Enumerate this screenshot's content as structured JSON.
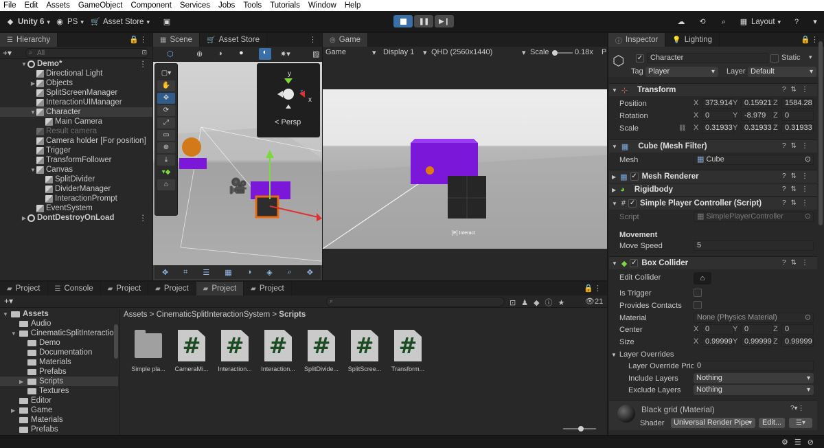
{
  "menu": [
    "File",
    "Edit",
    "Assets",
    "GameObject",
    "Component",
    "Services",
    "Jobs",
    "Tools",
    "Tutorials",
    "Window",
    "Help"
  ],
  "toolbar": {
    "unity_label": "Unity 6",
    "account_label": "PS",
    "asset_store_label": "Asset Store",
    "layout_label": "Layout"
  },
  "hierarchy": {
    "tab": "Hierarchy",
    "search_placeholder": "All",
    "items": [
      {
        "label": "Demo*",
        "indent": 0,
        "kind": "scene",
        "expanded": true
      },
      {
        "label": "Directional Light",
        "indent": 1,
        "kind": "go"
      },
      {
        "label": "Objects",
        "indent": 1,
        "kind": "go",
        "collapsed": true
      },
      {
        "label": "SplitScreenManager",
        "indent": 1,
        "kind": "go"
      },
      {
        "label": "InteractionUIManager",
        "indent": 1,
        "kind": "go"
      },
      {
        "label": "Character",
        "indent": 1,
        "kind": "go",
        "expanded": true,
        "selected": true
      },
      {
        "label": "Main Camera",
        "indent": 2,
        "kind": "go"
      },
      {
        "label": "Result camera",
        "indent": 1,
        "kind": "go",
        "disabled": true
      },
      {
        "label": "Camera holder [For position]",
        "indent": 1,
        "kind": "go"
      },
      {
        "label": "Trigger",
        "indent": 1,
        "kind": "go"
      },
      {
        "label": "TransformFollower",
        "indent": 1,
        "kind": "go"
      },
      {
        "label": "Canvas",
        "indent": 1,
        "kind": "go",
        "expanded": true
      },
      {
        "label": "SplitDivider",
        "indent": 2,
        "kind": "go"
      },
      {
        "label": "DividerManager",
        "indent": 2,
        "kind": "go"
      },
      {
        "label": "InteractionPrompt",
        "indent": 2,
        "kind": "go"
      },
      {
        "label": "EventSystem",
        "indent": 1,
        "kind": "go"
      },
      {
        "label": "DontDestroyOnLoad",
        "indent": 0,
        "kind": "scene",
        "collapsed": true
      }
    ]
  },
  "scene": {
    "tab": "Scene",
    "tab2": "Asset Store",
    "persp_label": "Persp",
    "gizmo_y": "y",
    "gizmo_x": "x",
    "gizmo_z": "z"
  },
  "game": {
    "tab": "Game",
    "mode": "Game",
    "display": "Display 1",
    "resolution": "QHD (2560x1440)",
    "scale_label": "Scale",
    "scale_value": "0.18x",
    "interact_text": "[E] Interact"
  },
  "project": {
    "tabs": [
      "Project",
      "Console",
      "Project",
      "Project",
      "Project",
      "Project"
    ],
    "active_tab": 4,
    "breadcrumb": [
      "Assets",
      "CinematicSplitInteractionSystem",
      "Scripts"
    ],
    "hidden_count": "21",
    "tree": [
      {
        "label": "Assets",
        "indent": 0,
        "expanded": true,
        "bold": true
      },
      {
        "label": "Audio",
        "indent": 1
      },
      {
        "label": "CinematicSplitInteraction",
        "indent": 1,
        "expanded": true
      },
      {
        "label": "Demo",
        "indent": 2
      },
      {
        "label": "Documentation",
        "indent": 2
      },
      {
        "label": "Materials",
        "indent": 2
      },
      {
        "label": "Prefabs",
        "indent": 2
      },
      {
        "label": "Scripts",
        "indent": 2,
        "selected": true,
        "collapsed": true
      },
      {
        "label": "Textures",
        "indent": 2
      },
      {
        "label": "Editor",
        "indent": 1
      },
      {
        "label": "Game",
        "indent": 1,
        "collapsed": true
      },
      {
        "label": "Materials",
        "indent": 1
      },
      {
        "label": "Prefabs",
        "indent": 1
      }
    ],
    "assets": [
      {
        "label": "Simple pla...",
        "type": "folder"
      },
      {
        "label": "CameraMi...",
        "type": "script"
      },
      {
        "label": "Interaction...",
        "type": "script"
      },
      {
        "label": "Interaction...",
        "type": "script"
      },
      {
        "label": "SplitDivide...",
        "type": "script"
      },
      {
        "label": "SplitScree...",
        "type": "script"
      },
      {
        "label": "Transform...",
        "type": "script"
      }
    ]
  },
  "inspector": {
    "tab": "Inspector",
    "tab2": "Lighting",
    "object_name": "Character",
    "static_label": "Static",
    "tag_label": "Tag",
    "tag_value": "Player",
    "layer_label": "Layer",
    "layer_value": "Default",
    "transform": {
      "title": "Transform",
      "position_label": "Position",
      "rotation_label": "Rotation",
      "scale_label": "Scale",
      "position": {
        "x": "373.914",
        "y": "0.15921:",
        "z": "1584.28"
      },
      "rotation": {
        "x": "0",
        "y": "-8.979",
        "z": "0"
      },
      "scale": {
        "x": "0.31933",
        "y": "0.31933",
        "z": "0.31933"
      }
    },
    "mesh_filter": {
      "title": "Cube (Mesh Filter)",
      "mesh_label": "Mesh",
      "mesh_value": "Cube"
    },
    "mesh_renderer": {
      "title": "Mesh Renderer"
    },
    "rigidbody": {
      "title": "Rigidbody"
    },
    "spc": {
      "title": "Simple Player Controller (Script)",
      "script_label": "Script",
      "script_value": "SimplePlayerController",
      "movement_header": "Movement",
      "move_speed_label": "Move Speed",
      "move_speed_value": "5"
    },
    "box_collider": {
      "title": "Box Collider",
      "edit_collider_label": "Edit Collider",
      "is_trigger_label": "Is Trigger",
      "provides_contacts_label": "Provides Contacts",
      "material_label": "Material",
      "material_value": "None (Physics Material)",
      "center_label": "Center",
      "center": {
        "x": "0",
        "y": "0",
        "z": "0"
      },
      "size_label": "Size",
      "size": {
        "x": "0.99999",
        "y": "0.99999",
        "z": "0.99999"
      },
      "layer_overrides_label": "Layer Overrides",
      "layer_override_priority_label": "Layer Override Pric",
      "layer_override_priority_value": "0",
      "include_layers_label": "Include Layers",
      "include_layers_value": "Nothing",
      "exclude_layers_label": "Exclude Layers",
      "exclude_layers_value": "Nothing"
    },
    "material": {
      "name": "Black grid (Material)",
      "shader_label": "Shader",
      "shader_value": "Universal Render Pipe",
      "edit_label": "Edit..."
    }
  },
  "colors": {
    "accent": "#3b6fa8",
    "purple": "#7a17d9",
    "orange": "#e07b12"
  }
}
